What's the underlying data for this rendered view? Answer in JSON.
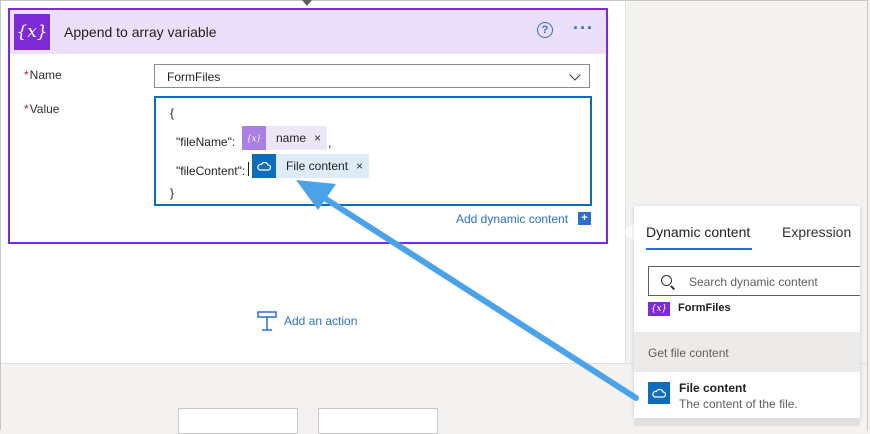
{
  "card": {
    "title": "Append to array variable",
    "icon_glyph": "{x}",
    "help_glyph": "?",
    "more_glyph": "···",
    "accent": "#7d2bd6",
    "header_bg": "#ecdffb"
  },
  "fields": {
    "required_mark": "*",
    "name_label": "Name",
    "name_value": "FormFiles",
    "value_label": "Value"
  },
  "value_editor": {
    "open_brace": "{",
    "line1_key": "\"fileName\":",
    "token1_icon": "{x}",
    "token1_label": "name",
    "token1_remove": "×",
    "line1_suffix": ",",
    "line2_key": "\"fileContent\":",
    "token2_label": "File content",
    "token2_remove": "×",
    "close_brace": "}"
  },
  "add_dynamic": {
    "label": "Add dynamic content",
    "plus": "+"
  },
  "add_action": {
    "label": "Add an action"
  },
  "panel": {
    "tabs": [
      "Dynamic content",
      "Expression"
    ],
    "search_placeholder": "Search dynamic content",
    "formfiles_icon": "{x}",
    "formfiles_label": "FormFiles",
    "section_title": "Get file content",
    "item_title": "File content",
    "item_desc": "The content of the file."
  },
  "colors": {
    "link_blue": "#2c6fd1",
    "onedrive_blue": "#0f6cbd",
    "token_var_bg": "#ece6f6",
    "token_file_bg": "#deecf9",
    "arrow": "#4aa3e8"
  },
  "icons": {
    "card": "variable-icon",
    "help": "help-circle-icon",
    "more": "ellipsis-icon",
    "token1": "variable-icon",
    "token2": "onedrive-cloud-icon",
    "search": "search-icon",
    "add_action": "add-action-icon"
  }
}
